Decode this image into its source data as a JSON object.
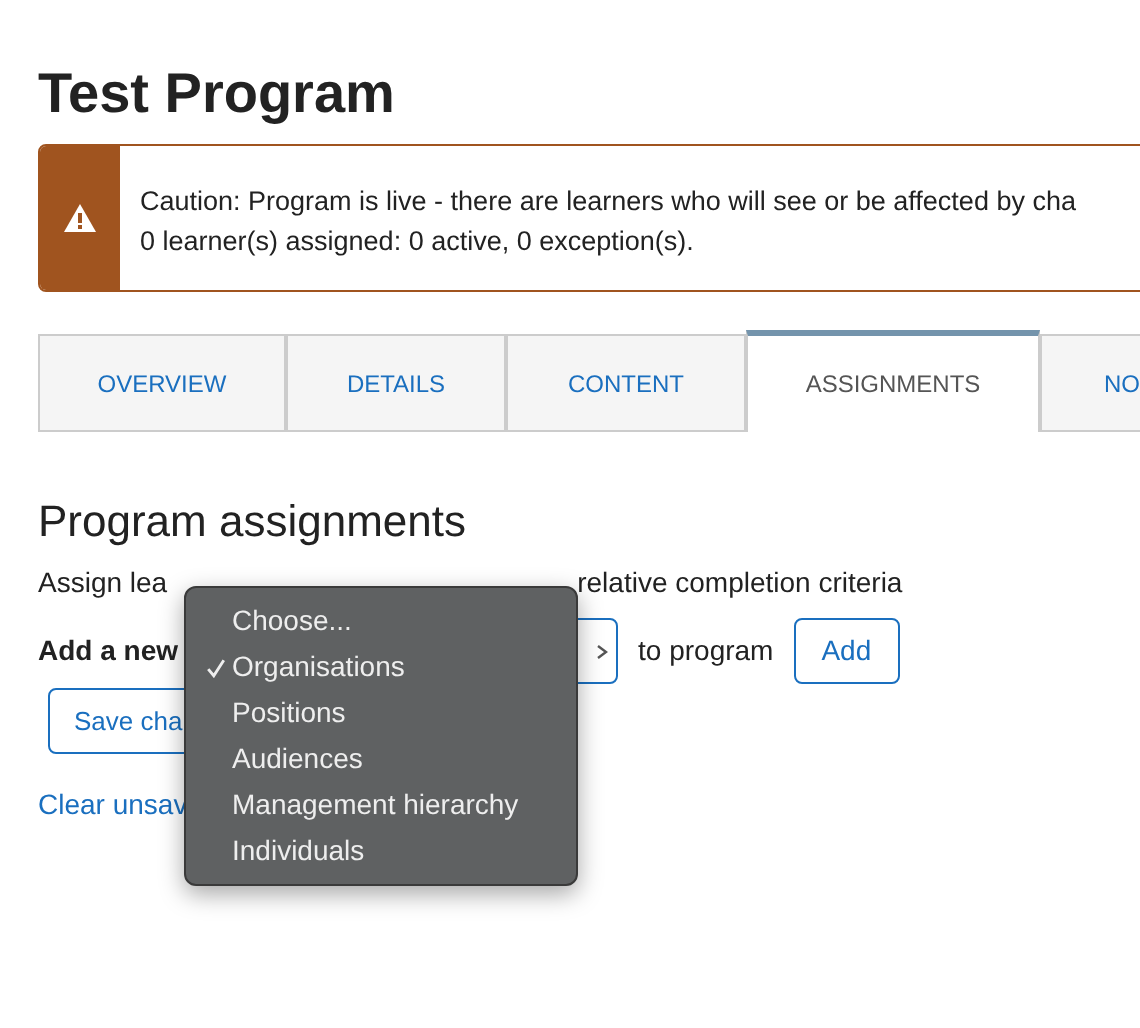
{
  "page_title": "Test Program",
  "alert": {
    "line_1": "Caution: Program is live - there are learners who will see or be affected by cha",
    "line_2": "0 learner(s) assigned: 0 active, 0 exception(s)."
  },
  "tabs": [
    {
      "label": "OVERVIEW",
      "selected": false
    },
    {
      "label": "DETAILS",
      "selected": false
    },
    {
      "label": "CONTENT",
      "selected": false
    },
    {
      "label": "ASSIGNMENTS",
      "selected": true
    },
    {
      "label": "NO",
      "selected": false
    }
  ],
  "section_heading": "Program assignments",
  "description": {
    "before_menu": "Assign lea",
    "after_menu": "relative completion criteria"
  },
  "add_row": {
    "label": "Add a new",
    "suffix": "to program",
    "add_button": "Add"
  },
  "save_button": "Save cha",
  "clear_link": "Clear unsav",
  "dropdown_menu": [
    {
      "label": "Choose...",
      "selected": false
    },
    {
      "label": "Organisations",
      "selected": true
    },
    {
      "label": "Positions",
      "selected": false
    },
    {
      "label": "Audiences",
      "selected": false
    },
    {
      "label": "Management hierarchy",
      "selected": false
    },
    {
      "label": "Individuals",
      "selected": false
    }
  ]
}
